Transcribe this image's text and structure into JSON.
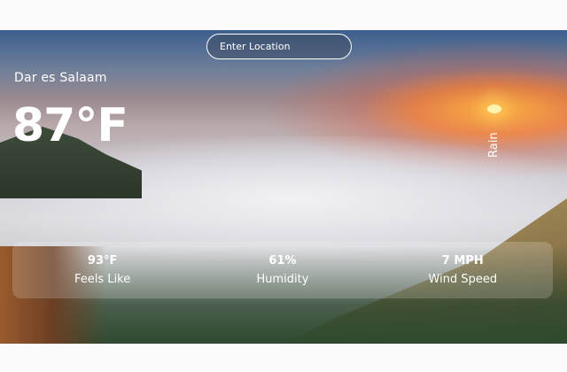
{
  "search": {
    "placeholder": "Enter Location"
  },
  "weather": {
    "city": "Dar es Salaam",
    "temperature": "87°F",
    "condition": "Rain"
  },
  "stats": [
    {
      "value": "93°F",
      "label": "Feels Like"
    },
    {
      "value": "61%",
      "label": "Humidity"
    },
    {
      "value": "7 MPH",
      "label": "Wind Speed"
    }
  ]
}
